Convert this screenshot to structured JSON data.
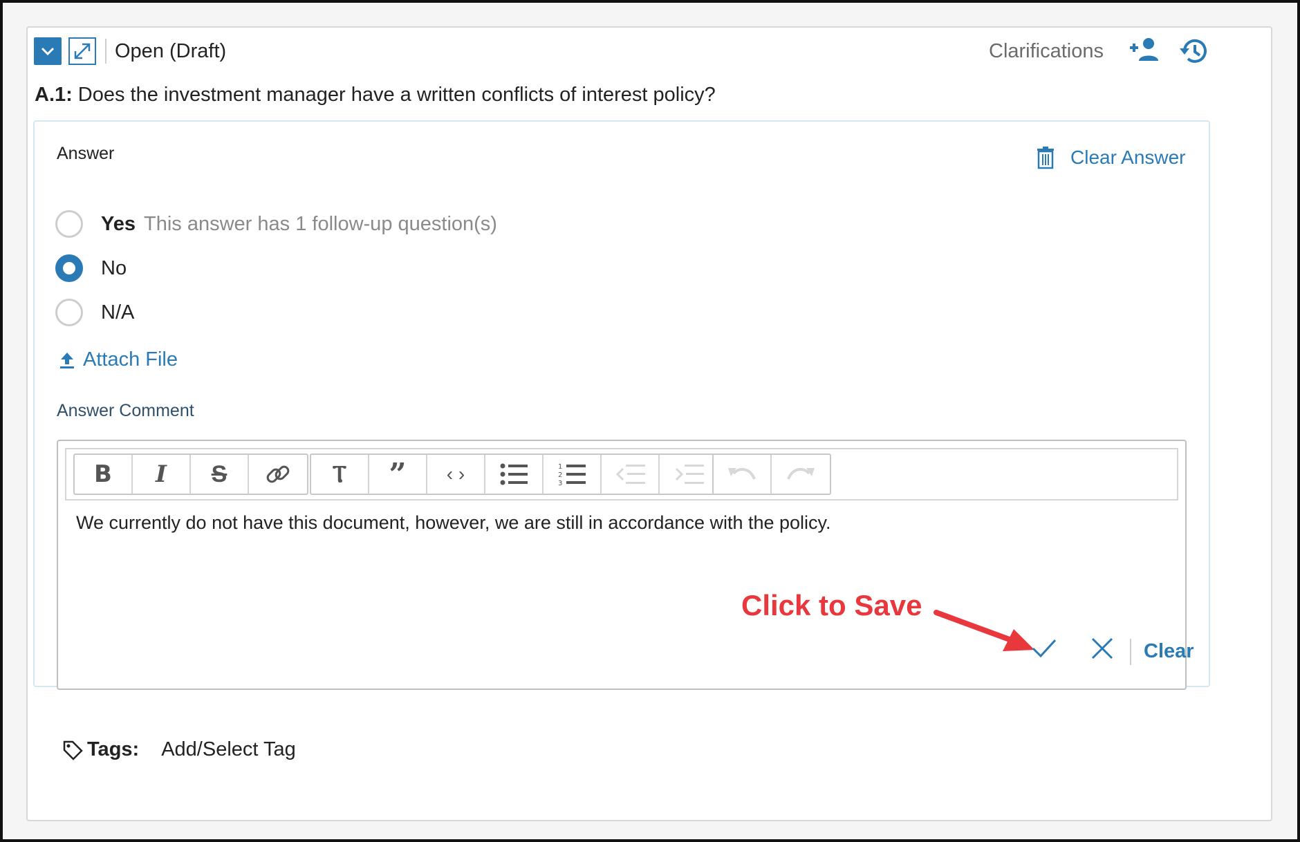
{
  "header": {
    "status": "Open (Draft)",
    "clarifications_label": "Clarifications",
    "icons": [
      "chevron-down-icon",
      "expand-icon",
      "add-user-icon",
      "history-icon"
    ]
  },
  "question": {
    "number": "A.1:",
    "text": "Does the investment manager have a written conflicts of interest policy?"
  },
  "answer": {
    "label": "Answer",
    "clear_answer_label": "Clear Answer",
    "options": [
      {
        "label": "Yes",
        "note": "This answer has 1 follow-up question(s)",
        "selected": false
      },
      {
        "label": "No",
        "note": "",
        "selected": true
      },
      {
        "label": "N/A",
        "note": "",
        "selected": false
      }
    ],
    "attach_label": "Attach File"
  },
  "comment": {
    "label": "Answer Comment",
    "text": "We currently do not have this document, however, we are still in accordance with the policy.",
    "toolbar": [
      "bold",
      "italic",
      "strikethrough",
      "link",
      "heading",
      "quote",
      "code",
      "bullet-list",
      "numbered-list",
      "outdent",
      "indent",
      "undo",
      "redo"
    ],
    "clear_label": "Clear"
  },
  "annotation": {
    "text": "Click to Save"
  },
  "tags": {
    "label": "Tags:",
    "add_label": "Add/Select Tag"
  },
  "colors": {
    "accent": "#2a7ab5",
    "annotation": "#e8383d",
    "panel_border": "#d5e6f3"
  }
}
